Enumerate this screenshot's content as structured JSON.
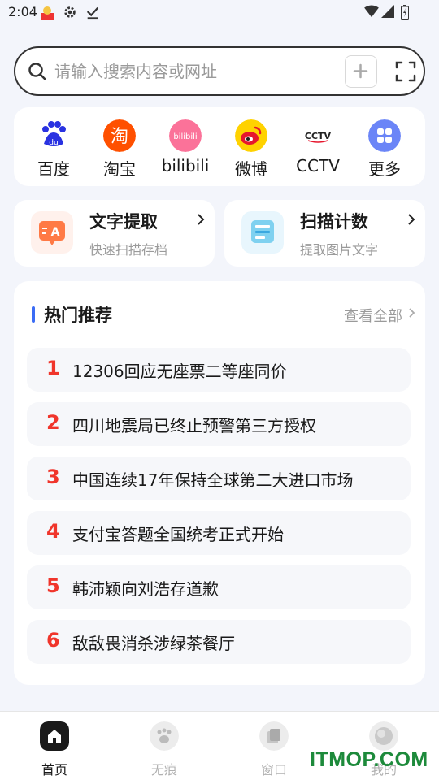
{
  "status_bar": {
    "time": "2:04"
  },
  "search": {
    "placeholder": "请输入搜索内容或网址",
    "value": ""
  },
  "shortcuts": [
    {
      "label": "百度",
      "icon": "baidu-icon",
      "color": "#2932e1"
    },
    {
      "label": "淘宝",
      "icon": "taobao-icon",
      "color": "#ff5000"
    },
    {
      "label": "bilibili",
      "icon": "bilibili-icon",
      "color": "#fb7299"
    },
    {
      "label": "微博",
      "icon": "weibo-icon",
      "color": "#e6162d"
    },
    {
      "label": "CCTV",
      "icon": "cctv-icon",
      "color": "#222222"
    },
    {
      "label": "更多",
      "icon": "more-grid-icon",
      "color": "#5b7cf7"
    }
  ],
  "tools": [
    {
      "title": "文字提取",
      "subtitle": "快速扫描存档"
    },
    {
      "title": "扫描计数",
      "subtitle": "提取图片文字"
    }
  ],
  "hot": {
    "title": "热门推荐",
    "view_all": "查看全部",
    "items": [
      {
        "rank": "1",
        "text": "12306回应无座票二等座同价"
      },
      {
        "rank": "2",
        "text": "四川地震局已终止预警第三方授权"
      },
      {
        "rank": "3",
        "text": "中国连续17年保持全球第二大进口市场"
      },
      {
        "rank": "4",
        "text": "支付宝答题全国统考正式开始"
      },
      {
        "rank": "5",
        "text": "韩沛颖向刘浩存道歉"
      },
      {
        "rank": "6",
        "text": "敌敌畏消杀涉绿茶餐厅"
      }
    ]
  },
  "nav": [
    {
      "label": "首页",
      "icon": "home-icon",
      "active": true
    },
    {
      "label": "无痕",
      "icon": "paw-icon",
      "active": false
    },
    {
      "label": "窗口",
      "icon": "window-icon",
      "active": false
    },
    {
      "label": "我的",
      "icon": "profile-icon",
      "active": false
    }
  ],
  "watermark": "ITMOP.COM",
  "colors": {
    "accent": "#3b6cf5",
    "rank": "#f0352b",
    "background": "#f3f5fb"
  }
}
